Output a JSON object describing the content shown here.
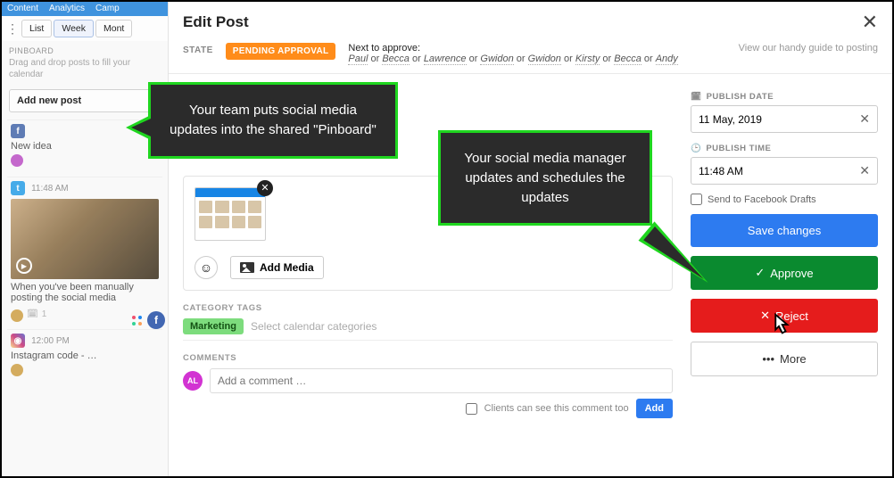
{
  "topnav": {
    "item1": "Content",
    "item2": "Analytics",
    "item3": "Camp"
  },
  "views": {
    "list": "List",
    "week": "Week",
    "month": "Mont"
  },
  "pinboard": {
    "heading": "PINBOARD",
    "help": "Drag and drop posts to fill your calendar",
    "add_label": "Add new post"
  },
  "cards": {
    "c1": {
      "title": "New idea"
    },
    "c2": {
      "time": "11:48 AM",
      "title": "When you've been manually posting the social media",
      "count": "1"
    },
    "c3": {
      "time": "12:00 PM",
      "title": "Instagram code - …"
    }
  },
  "modal": {
    "title": "Edit Post",
    "state_label": "STATE",
    "state_pill": "PENDING APPROVAL",
    "next_label": "Next to approve:",
    "approvers": [
      "Paul",
      "Becca",
      "Lawrence",
      "Gwidon",
      "Gwidon",
      "Kirsty",
      "Becca",
      "Andy"
    ],
    "or": "or",
    "guide": "View our handy guide to posting"
  },
  "media": {
    "add_label": "Add Media"
  },
  "tags": {
    "section": "CATEGORY TAGS",
    "tag1": "Marketing",
    "placeholder": "Select calendar categories"
  },
  "comments": {
    "section": "COMMENTS",
    "avatar": "AL",
    "placeholder": "Add a comment …",
    "clients_label": "Clients can see this comment too",
    "add_btn": "Add"
  },
  "side": {
    "date_label": "PUBLISH DATE",
    "date_value": "11 May, 2019",
    "time_label": "PUBLISH TIME",
    "time_value": "11:48 AM",
    "fb_drafts": "Send to Facebook Drafts",
    "save": "Save changes",
    "approve": "Approve",
    "reject": "Reject",
    "more": "More"
  },
  "callouts": {
    "c1": "Your team puts social media updates into the shared \"Pinboard\"",
    "c2": "Your social media manager updates and schedules the updates"
  }
}
